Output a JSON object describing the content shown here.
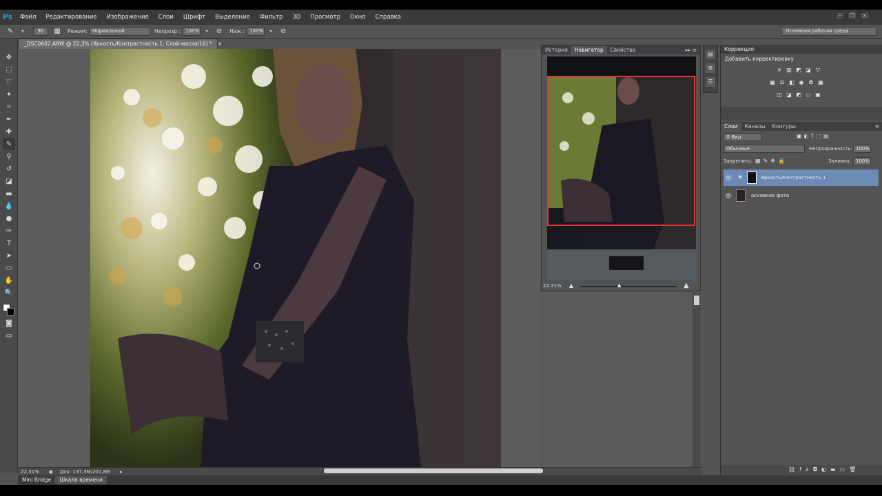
{
  "menu": {
    "logo": "Ps",
    "items": [
      "Файл",
      "Редактирование",
      "Изображение",
      "Слои",
      "Шрифт",
      "Выделение",
      "Фильтр",
      "3D",
      "Просмотр",
      "Окно",
      "Справка"
    ]
  },
  "options": {
    "brush_size": "90",
    "mode_label": "Режим:",
    "mode_value": "Нормальный",
    "opacity_label": "Непрозр.:",
    "opacity_value": "100%",
    "flow_label": "Наж.:",
    "flow_value": "100%",
    "workspace": "Основная рабочая среда"
  },
  "document": {
    "tab_title": "_DSC0602.ARW @ 22,3% (Яркость/Контрастность 1, Слой-маска/16) *",
    "close": "×"
  },
  "status": {
    "zoom": "22,31%",
    "doc_info": "Док: 137,3M/201,8M"
  },
  "bottom_tabs": [
    "Mini Bridge",
    "Шкала времени"
  ],
  "nav_panel": {
    "tabs": [
      "История",
      "Навигатор",
      "Свойства"
    ],
    "zoom": "22.31%"
  },
  "correction": {
    "title": "Коррекция",
    "subtitle": "Добавить корректировку"
  },
  "layers_panel": {
    "tabs": [
      "Слои",
      "Каналы",
      "Контуры"
    ],
    "filter": "Вид",
    "blend_mode": "Обычные",
    "opacity_label": "Непрозрачность:",
    "opacity_value": "100%",
    "lock_label": "Закрепить:",
    "fill_label": "Заливка:",
    "fill_value": "100%",
    "layers": [
      {
        "name": "Яркость/Контрастность 1",
        "selected": true
      },
      {
        "name": "основное фото",
        "selected": false
      }
    ]
  },
  "colors": {
    "selection": "#6b8ab5",
    "nav_box": "#ee3333",
    "ps_blue": "#2fa3e6"
  }
}
